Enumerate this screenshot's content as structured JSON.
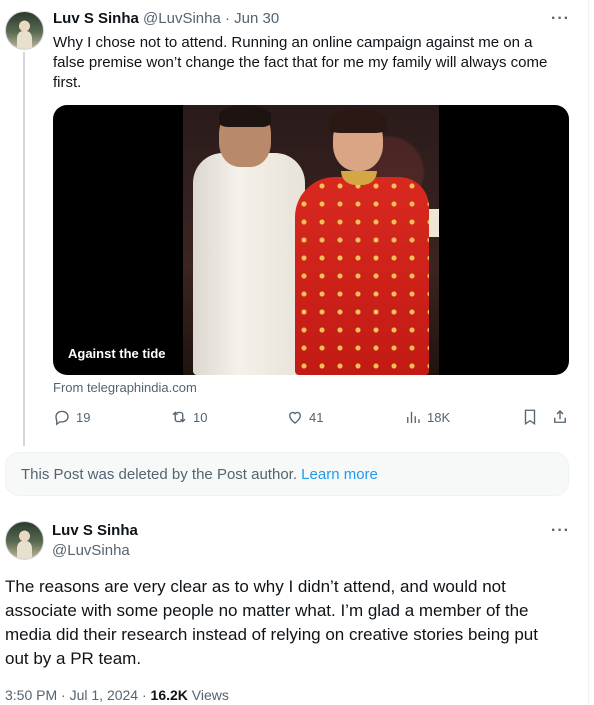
{
  "tweet1": {
    "display_name": "Luv S Sinha",
    "handle": "@LuvSinha",
    "separator": "·",
    "date": "Jun 30",
    "text": "Why I chose not to attend. Running an online campaign against me on a false premise won’t change the fact that for me my family will always come first.",
    "card": {
      "caption": "Against the tide",
      "source": "From telegraphindia.com"
    },
    "actions": {
      "replies": "19",
      "reposts": "10",
      "likes": "41",
      "views": "18K"
    }
  },
  "deleted_notice": {
    "text": "This Post was deleted by the Post author.",
    "link": "Learn more"
  },
  "tweet2": {
    "display_name": "Luv S Sinha",
    "handle": "@LuvSinha",
    "text": "The reasons are very clear as to why I didn’t attend, and would not associate with some people no matter what. I’m glad a member of the media did their research instead of relying on creative stories being put out by a PR team.",
    "time": "3:50 PM",
    "date": "Jul 1, 2024",
    "views_count": "16.2K",
    "views_label": "Views"
  },
  "more_glyph": "···",
  "colors": {
    "text": "#0f1419",
    "muted": "#536471",
    "link": "#1d9bf0",
    "border": "#cfd9de"
  }
}
